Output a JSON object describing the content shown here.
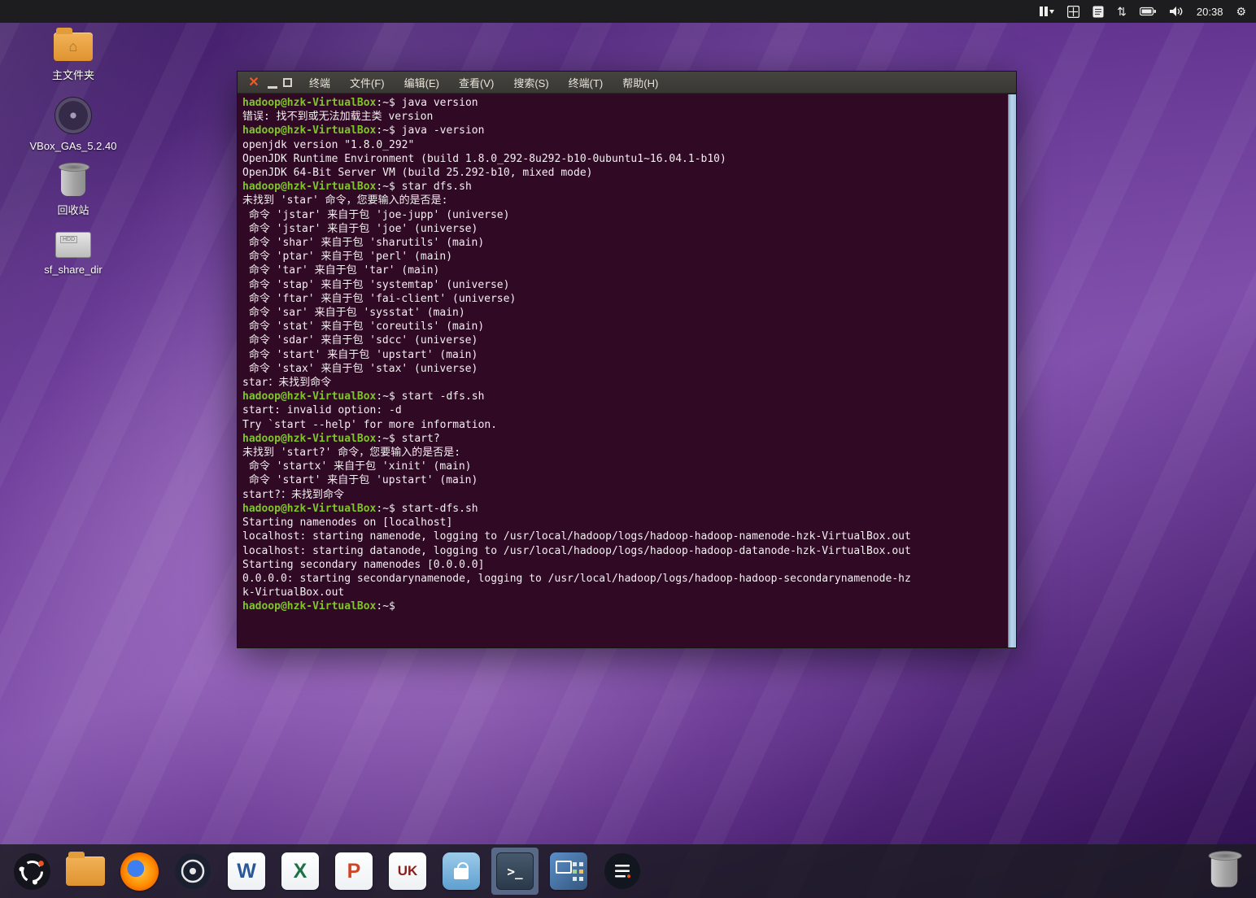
{
  "topbar": {
    "time": "20:38",
    "icons": {
      "arrows_glyph": "⇅",
      "gear_glyph": "⚙"
    }
  },
  "desktop": {
    "icons": [
      {
        "label": "主文件夹"
      },
      {
        "label": "VBox_GAs_5.2.40"
      },
      {
        "label": "回收站"
      },
      {
        "label": "sf_share_dir",
        "badge": "HDD"
      }
    ]
  },
  "terminal": {
    "menu": [
      "终端",
      "文件(F)",
      "编辑(E)",
      "查看(V)",
      "搜索(S)",
      "终端(T)",
      "帮助(H)"
    ],
    "colors": {
      "background": "#300a24",
      "prompt_green": "#7fc529",
      "text": "#f3eef2"
    },
    "lines": [
      [
        {
          "c": "p",
          "t": "hadoop@hzk-VirtualBox"
        },
        {
          "c": "t",
          "t": ":~$ java version"
        }
      ],
      [
        {
          "c": "t",
          "t": "错误: 找不到或无法加载主类 version"
        }
      ],
      [
        {
          "c": "p",
          "t": "hadoop@hzk-VirtualBox"
        },
        {
          "c": "t",
          "t": ":~$ java -version"
        }
      ],
      [
        {
          "c": "t",
          "t": "openjdk version \"1.8.0_292\""
        }
      ],
      [
        {
          "c": "t",
          "t": "OpenJDK Runtime Environment (build 1.8.0_292-8u292-b10-0ubuntu1~16.04.1-b10)"
        }
      ],
      [
        {
          "c": "t",
          "t": "OpenJDK 64-Bit Server VM (build 25.292-b10, mixed mode)"
        }
      ],
      [
        {
          "c": "p",
          "t": "hadoop@hzk-VirtualBox"
        },
        {
          "c": "t",
          "t": ":~$ star dfs.sh"
        }
      ],
      [
        {
          "c": "t",
          "t": "未找到 'star' 命令，您要输入的是否是:"
        }
      ],
      [
        {
          "c": "t",
          "t": " 命令 'jstar' 来自于包 'joe-jupp' (universe)"
        }
      ],
      [
        {
          "c": "t",
          "t": " 命令 'jstar' 来自于包 'joe' (universe)"
        }
      ],
      [
        {
          "c": "t",
          "t": " 命令 'shar' 来自于包 'sharutils' (main)"
        }
      ],
      [
        {
          "c": "t",
          "t": " 命令 'ptar' 来自于包 'perl' (main)"
        }
      ],
      [
        {
          "c": "t",
          "t": " 命令 'tar' 来自于包 'tar' (main)"
        }
      ],
      [
        {
          "c": "t",
          "t": " 命令 'stap' 来自于包 'systemtap' (universe)"
        }
      ],
      [
        {
          "c": "t",
          "t": " 命令 'ftar' 来自于包 'fai-client' (universe)"
        }
      ],
      [
        {
          "c": "t",
          "t": " 命令 'sar' 来自于包 'sysstat' (main)"
        }
      ],
      [
        {
          "c": "t",
          "t": " 命令 'stat' 来自于包 'coreutils' (main)"
        }
      ],
      [
        {
          "c": "t",
          "t": " 命令 'sdar' 来自于包 'sdcc' (universe)"
        }
      ],
      [
        {
          "c": "t",
          "t": " 命令 'start' 来自于包 'upstart' (main)"
        }
      ],
      [
        {
          "c": "t",
          "t": " 命令 'stax' 来自于包 'stax' (universe)"
        }
      ],
      [
        {
          "c": "t",
          "t": "star：未找到命令"
        }
      ],
      [
        {
          "c": "p",
          "t": "hadoop@hzk-VirtualBox"
        },
        {
          "c": "t",
          "t": ":~$ start -dfs.sh"
        }
      ],
      [
        {
          "c": "t",
          "t": "start: invalid option: -d"
        }
      ],
      [
        {
          "c": "t",
          "t": "Try `start --help' for more information."
        }
      ],
      [
        {
          "c": "p",
          "t": "hadoop@hzk-VirtualBox"
        },
        {
          "c": "t",
          "t": ":~$ start?"
        }
      ],
      [
        {
          "c": "t",
          "t": "未找到 'start?' 命令，您要输入的是否是:"
        }
      ],
      [
        {
          "c": "t",
          "t": " 命令 'startx' 来自于包 'xinit' (main)"
        }
      ],
      [
        {
          "c": "t",
          "t": " 命令 'start' 来自于包 'upstart' (main)"
        }
      ],
      [
        {
          "c": "t",
          "t": "start?：未找到命令"
        }
      ],
      [
        {
          "c": "p",
          "t": "hadoop@hzk-VirtualBox"
        },
        {
          "c": "t",
          "t": ":~$ start-dfs.sh"
        }
      ],
      [
        {
          "c": "t",
          "t": "Starting namenodes on [localhost]"
        }
      ],
      [
        {
          "c": "t",
          "t": "localhost: starting namenode, logging to /usr/local/hadoop/logs/hadoop-hadoop-namenode-hzk-VirtualBox.out"
        }
      ],
      [
        {
          "c": "t",
          "t": "localhost: starting datanode, logging to /usr/local/hadoop/logs/hadoop-hadoop-datanode-hzk-VirtualBox.out"
        }
      ],
      [
        {
          "c": "t",
          "t": "Starting secondary namenodes [0.0.0.0]"
        }
      ],
      [
        {
          "c": "t",
          "t": "0.0.0.0: starting secondarynamenode, logging to /usr/local/hadoop/logs/hadoop-hadoop-secondarynamenode-hz"
        }
      ],
      [
        {
          "c": "t",
          "t": "k-VirtualBox.out"
        }
      ],
      [
        {
          "c": "p",
          "t": "hadoop@hzk-VirtualBox"
        },
        {
          "c": "t",
          "t": ":~$ "
        }
      ]
    ]
  },
  "dock": {
    "items": [
      {
        "name": "launcher-kylin-menu"
      },
      {
        "name": "file-manager"
      },
      {
        "name": "firefox"
      },
      {
        "name": "media-player"
      },
      {
        "name": "word",
        "glyph": "W"
      },
      {
        "name": "excel",
        "glyph": "X"
      },
      {
        "name": "powerpoint",
        "glyph": "P"
      },
      {
        "name": "software-center-uk",
        "glyph": "UK"
      },
      {
        "name": "software-store"
      },
      {
        "name": "terminal",
        "glyph": ">_",
        "active": true
      },
      {
        "name": "screenshot-tool"
      },
      {
        "name": "system-assistant"
      },
      {
        "name": "trash"
      }
    ]
  }
}
